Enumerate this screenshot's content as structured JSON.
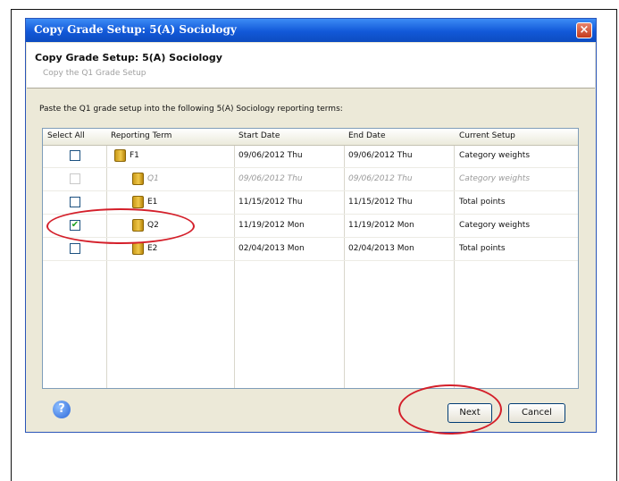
{
  "dialog": {
    "title": "Copy Grade Setup: 5(A) Sociology",
    "heading": "Copy Grade Setup: 5(A) Sociology",
    "subheading": "Copy the Q1 Grade Setup",
    "instructions": "Paste the Q1 grade setup into the following 5(A) Sociology reporting terms:"
  },
  "table": {
    "columns": [
      "Select All",
      "Reporting Term",
      "Start Date",
      "End Date",
      "Current Setup"
    ],
    "rows": [
      {
        "term": "F1",
        "start": "09/06/2012 Thu",
        "end": "09/06/2012 Thu",
        "setup": "Category weights",
        "checked": false,
        "disabled": false,
        "indent": 0
      },
      {
        "term": "Q1",
        "start": "09/06/2012 Thu",
        "end": "09/06/2012 Thu",
        "setup": "Category weights",
        "checked": false,
        "disabled": true,
        "indent": 1
      },
      {
        "term": "E1",
        "start": "11/15/2012 Thu",
        "end": "11/15/2012 Thu",
        "setup": "Total points",
        "checked": false,
        "disabled": false,
        "indent": 1
      },
      {
        "term": "Q2",
        "start": "11/19/2012 Mon",
        "end": "11/19/2012 Mon",
        "setup": "Category weights",
        "checked": true,
        "disabled": false,
        "indent": 1
      },
      {
        "term": "E2",
        "start": "02/04/2013 Mon",
        "end": "02/04/2013 Mon",
        "setup": "Total points",
        "checked": false,
        "disabled": false,
        "indent": 1
      }
    ]
  },
  "buttons": {
    "next": "Next",
    "cancel": "Cancel",
    "help": "?",
    "close": "×"
  },
  "colors": {
    "titlebar": "#1258d8",
    "annotation": "#d41f2a"
  }
}
